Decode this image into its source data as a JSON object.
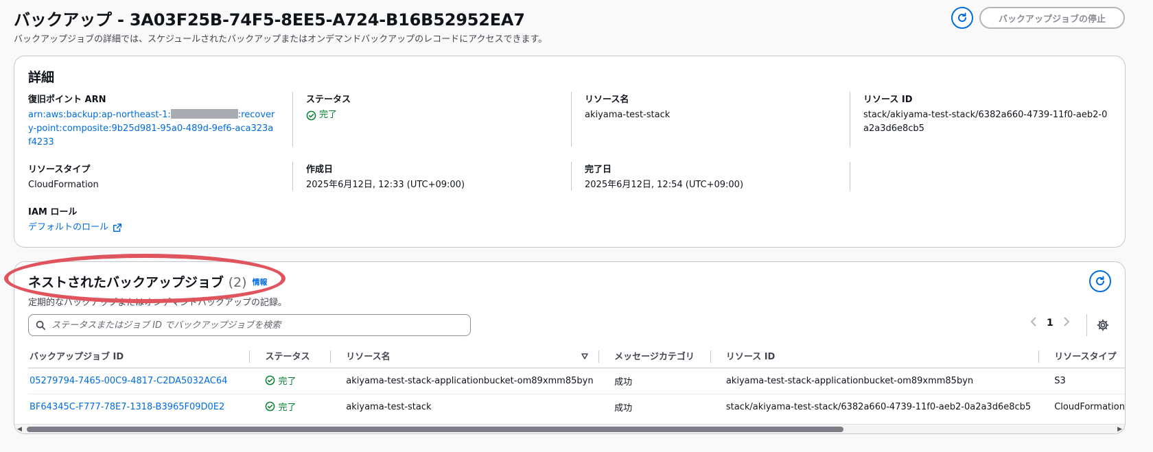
{
  "header": {
    "title": "バックアップ - 3A03F25B-74F5-8EE5-A724-B16B52952EA7",
    "description": "バックアップジョブの詳細では、スケジュールされたバックアップまたはオンデマンドバックアップのレコードにアクセスできます。",
    "stop_button": "バックアップジョブの停止"
  },
  "details": {
    "title": "詳細",
    "recovery_point": {
      "label": "復旧ポイント ARN",
      "value_prefix": "arn:aws:backup:ap-northeast-1:",
      "value_suffix": ":recovery-point:composite:9b25d981-95a0-489d-9ef6-aca323af4233"
    },
    "status": {
      "label": "ステータス",
      "value": "完了"
    },
    "resource_name": {
      "label": "リソース名",
      "value": "akiyama-test-stack"
    },
    "resource_id": {
      "label": "リソース ID",
      "value": "stack/akiyama-test-stack/6382a660-4739-11f0-aeb2-0a2a3d6e8cb5"
    },
    "resource_type": {
      "label": "リソースタイプ",
      "value": "CloudFormation"
    },
    "created": {
      "label": "作成日",
      "value": "2025年6月12日, 12:33 (UTC+09:00)"
    },
    "completed": {
      "label": "完了日",
      "value": "2025年6月12日, 12:54 (UTC+09:00)"
    },
    "iam_role": {
      "label": "IAM ロール",
      "value": "デフォルトのロール"
    }
  },
  "nested": {
    "title": "ネストされたバックアップジョブ",
    "count": "(2)",
    "info": "情報",
    "description": "定期的なバックアップまたはオンデマンドバックアップの記録。",
    "search_placeholder": "ステータスまたはジョブ ID でバックアップジョブを検索",
    "page": "1",
    "columns": [
      "バックアップジョブ ID",
      "ステータス",
      "リソース名",
      "メッセージカテゴリ",
      "リソース ID",
      "リソースタイプ"
    ],
    "rows": [
      {
        "job_id": "05279794-7465-00C9-4817-C2DA5032AC64",
        "status": "完了",
        "resource_name": "akiyama-test-stack-applicationbucket-om89xmm85byn",
        "message_category": "成功",
        "resource_id": "akiyama-test-stack-applicationbucket-om89xmm85byn",
        "resource_type": "S3"
      },
      {
        "job_id": "BF64345C-F777-78E7-1318-B3965F09D0E2",
        "status": "完了",
        "resource_name": "akiyama-test-stack",
        "message_category": "成功",
        "resource_id": "stack/akiyama-test-stack/6382a660-4739-11f0-aeb2-0a2a3d6e8cb5",
        "resource_type": "CloudFormation"
      }
    ]
  },
  "colors": {
    "link": "#006ce0",
    "success": "#00802f",
    "annotation": "#e0545e"
  }
}
